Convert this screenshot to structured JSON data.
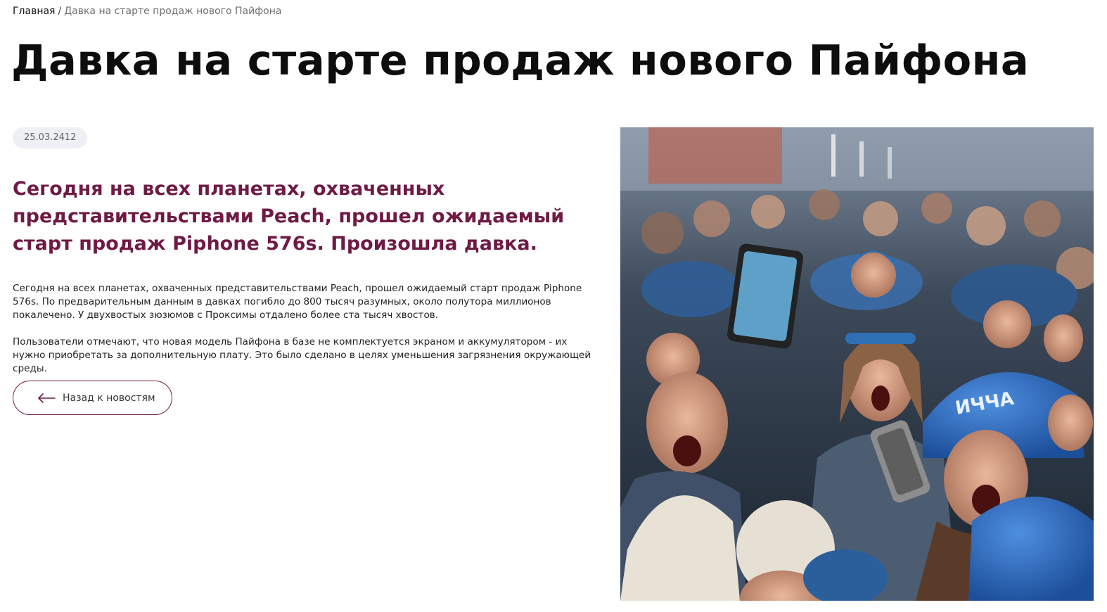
{
  "breadcrumb": {
    "home": "Главная",
    "separator": "/",
    "current": "Давка на старте продаж нового Пайфона"
  },
  "article": {
    "title": "Давка на старте продаж нового Пайфона",
    "date": "25.03.2412",
    "lead": "Сегодня на всех планетах, охваченных представительствами Peach, прошел ожидаемый старт продаж Piphone 576s. Произошла давка.",
    "paragraphs": [
      "Сегодня на всех планетах, охваченных представительствами Peach, прошел ожидаемый старт продаж Piphone 576s. По предварительным данным в давках погибло до 800 тысяч разумных, около полутора миллионов покалечено. У двухвостых зюзюмов с Проксимы отдалено более ста тысяч хвостов.",
      "Пользователи отмечают, что новая модель Пайфона в базе не комплектуется экраном и аккумулятором - их нужно приобретать за дополнительную плату. Это было сделано в целях уменьшения загрязнения окружающей среды."
    ],
    "back_label": "Назад к новостям"
  },
  "colors": {
    "accent": "#6f1a45",
    "badge_bg": "#eef0f3",
    "crowd_blue": "#2f6fb4"
  },
  "icons": {
    "back": "arrow-left-icon"
  }
}
